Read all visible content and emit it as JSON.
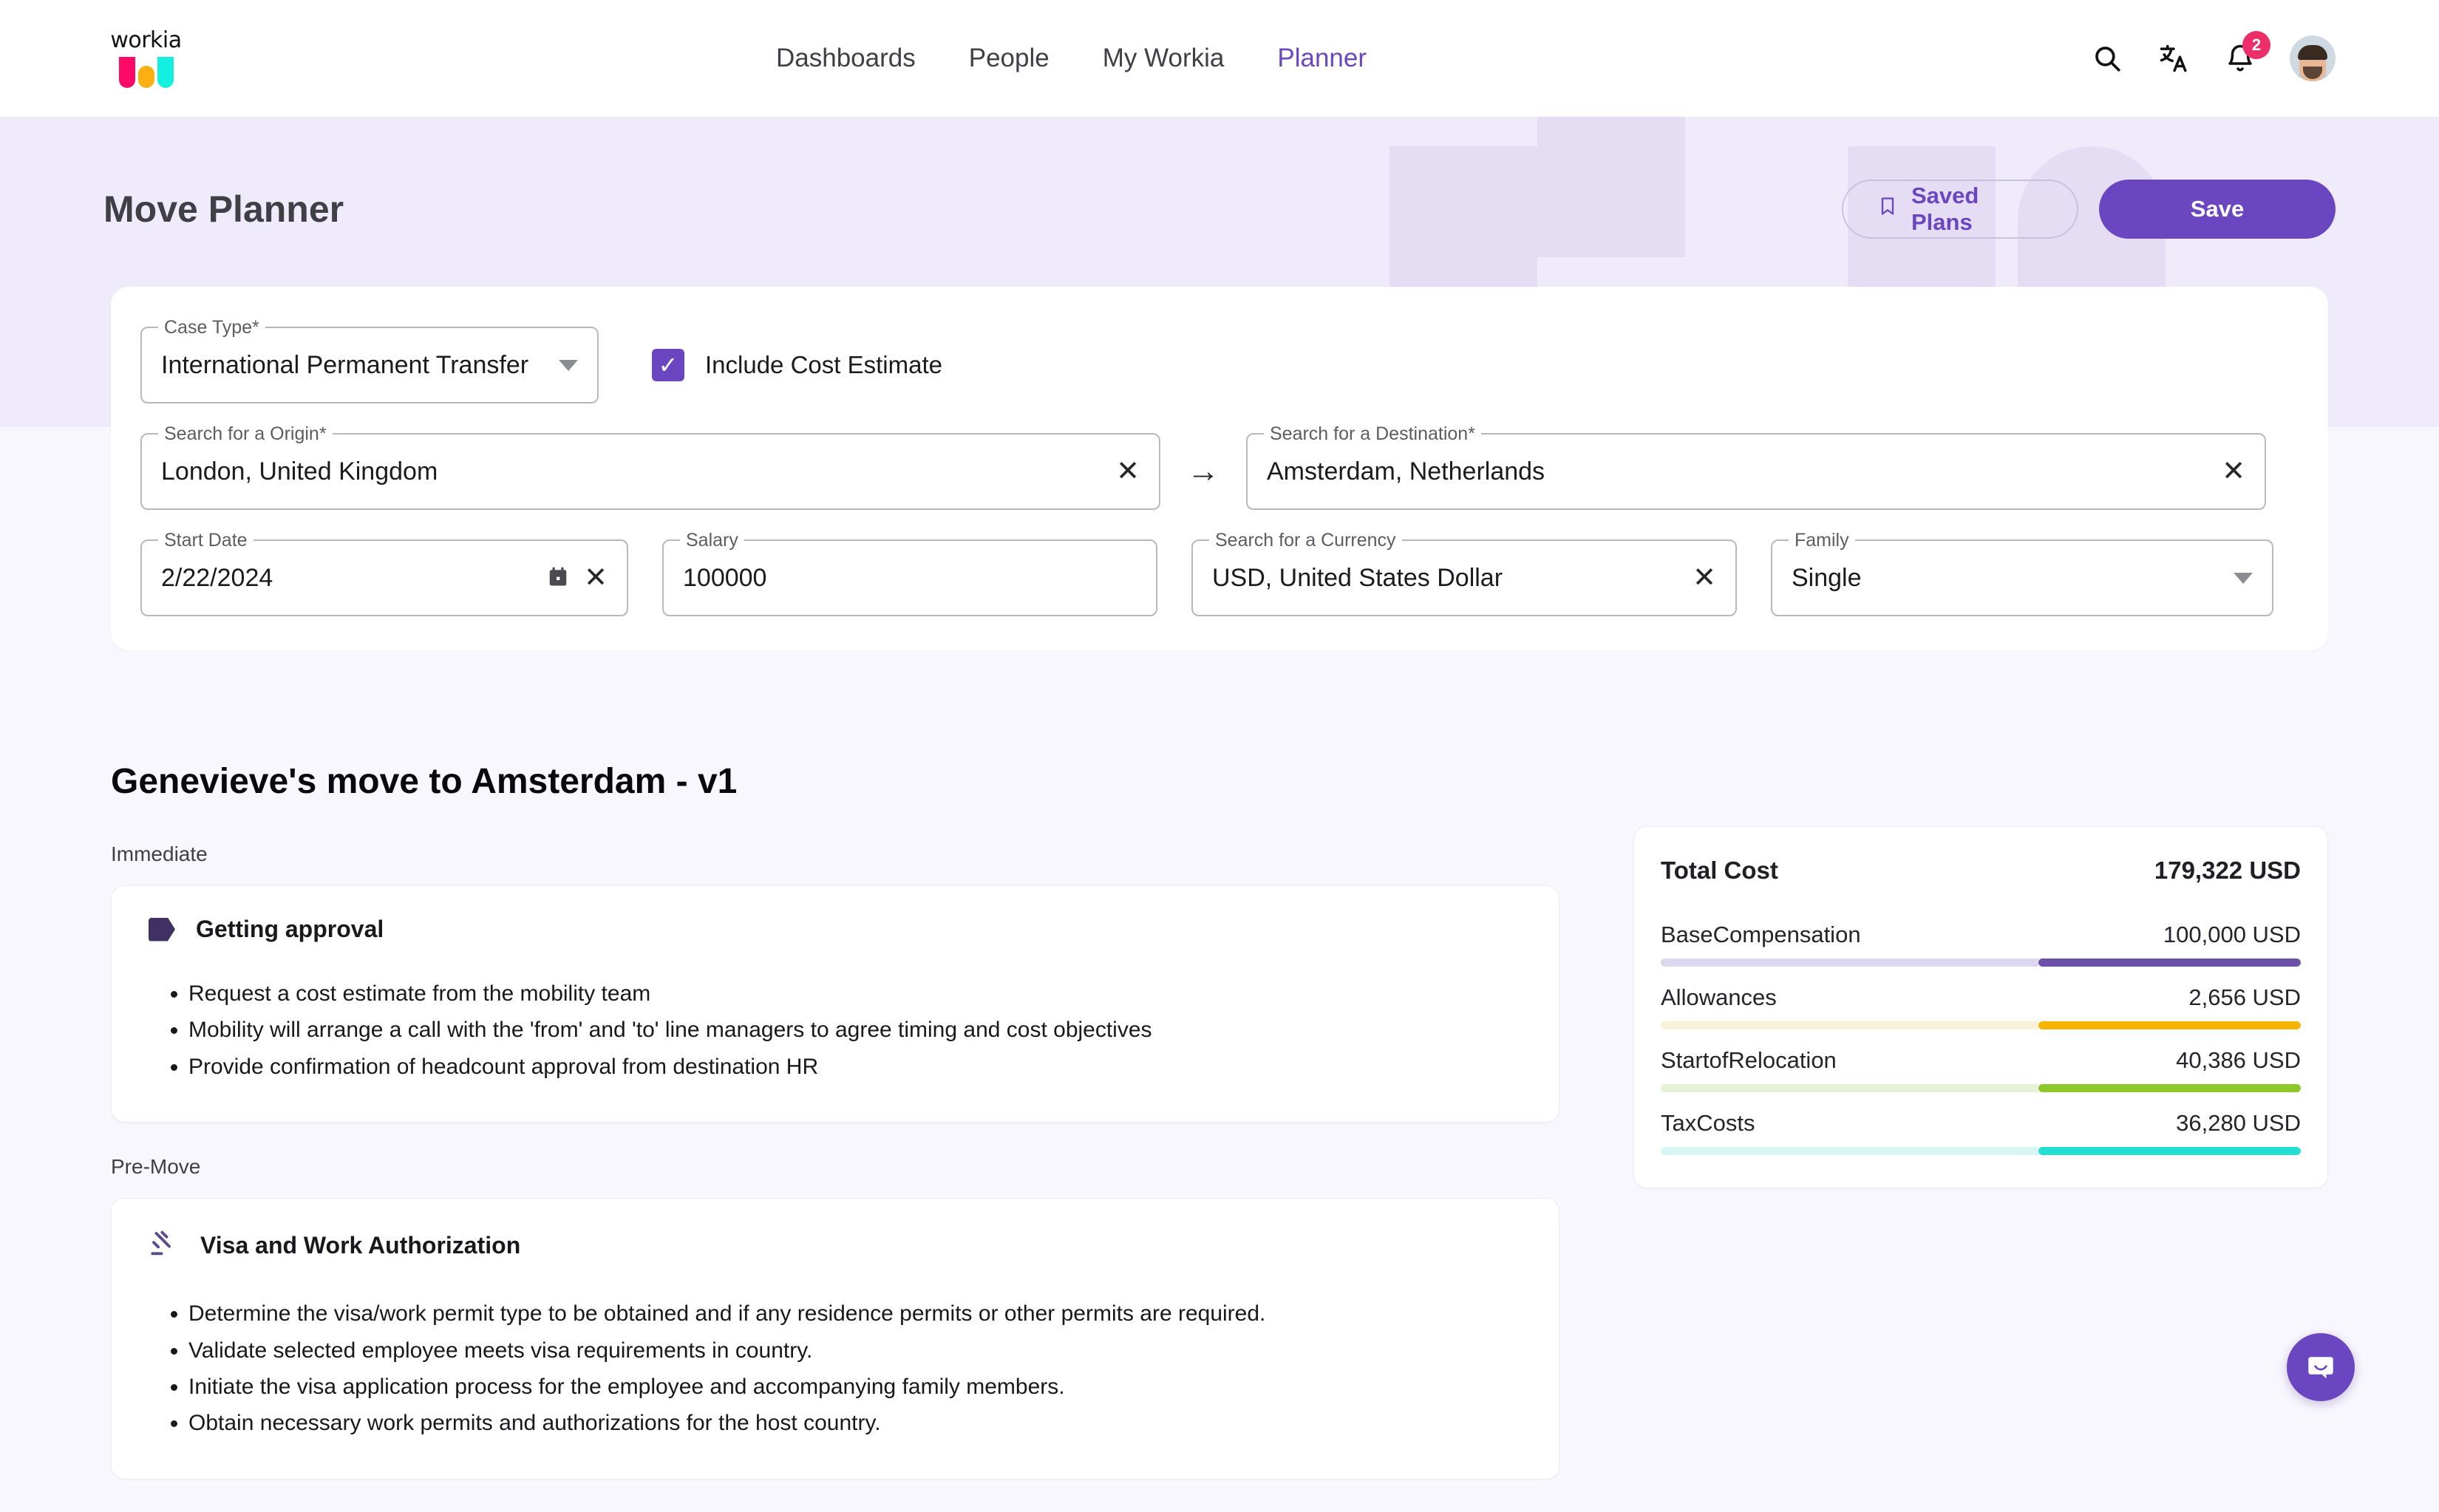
{
  "brand": {
    "logo_text": "workia",
    "colors": {
      "pink": "#ff0a67",
      "amber": "#f9b010",
      "cyan": "#14f0e0",
      "primary": "#6b46c1"
    }
  },
  "nav": {
    "items": [
      {
        "label": "Dashboards",
        "active": false
      },
      {
        "label": "People",
        "active": false
      },
      {
        "label": "My Workia",
        "active": false
      },
      {
        "label": "Planner",
        "active": true
      }
    ],
    "icons": [
      "search-icon",
      "translate-icon",
      "bell-icon"
    ],
    "notification_count": "2"
  },
  "hero": {
    "title": "Move Planner",
    "saved_plans_label": "Saved Plans",
    "save_label": "Save"
  },
  "form": {
    "case_type": {
      "label": "Case Type*",
      "value": "International Permanent Transfer"
    },
    "include_cost_estimate": {
      "label": "Include Cost Estimate",
      "checked": true
    },
    "origin": {
      "label": "Search for a Origin*",
      "value": "London, United Kingdom"
    },
    "destination": {
      "label": "Search for a Destination*",
      "value": "Amsterdam, Netherlands"
    },
    "start_date": {
      "label": "Start Date",
      "value": "2/22/2024"
    },
    "salary": {
      "label": "Salary",
      "value": "100000"
    },
    "currency": {
      "label": "Search for a Currency",
      "value": "USD, United States Dollar"
    },
    "family": {
      "label": "Family",
      "value": "Single"
    }
  },
  "plan": {
    "title": "Genevieve's move to Amsterdam - v1",
    "sections": [
      {
        "label": "Immediate",
        "card": {
          "icon": "tag-icon",
          "title": "Getting approval",
          "items": [
            "Request a cost estimate from the mobility team",
            "Mobility will arrange a call with the 'from' and 'to' line managers to agree timing and cost objectives",
            "Provide confirmation of headcount approval from destination HR"
          ]
        }
      },
      {
        "label": "Pre-Move",
        "card": {
          "icon": "gavel-icon",
          "title": "Visa and Work Authorization",
          "items": [
            "Determine the visa/work permit type to be obtained and if any residence permits or other permits are required.",
            "Validate selected employee meets visa requirements in country.",
            "Initiate the visa application process for the employee and accompanying family members.",
            "Obtain necessary work permits and authorizations for the host country."
          ]
        }
      }
    ]
  },
  "chart_data": {
    "type": "bar",
    "title": "Total Cost",
    "total_label": "Total Cost",
    "total_value": "179,322 USD",
    "currency": "USD",
    "categories": [
      "BaseCompensation",
      "Allowances",
      "StartofRelocation",
      "TaxCosts"
    ],
    "values": [
      100000,
      2656,
      40386,
      36280
    ],
    "value_labels": [
      "100,000 USD",
      "2,656 USD",
      "40,386 USD",
      "36,280 USD"
    ],
    "fill_percents": [
      41,
      41,
      41,
      41
    ],
    "colors": [
      "#6b51a8",
      "#f6b400",
      "#8dc82b",
      "#22dfd2"
    ],
    "track_colors": [
      "#ded8ef",
      "#fbf0d8",
      "#e7f1d6",
      "#d8f7f4"
    ],
    "legend": "none",
    "grid": false
  },
  "chat": {
    "icon": "chat-bubble-icon"
  }
}
